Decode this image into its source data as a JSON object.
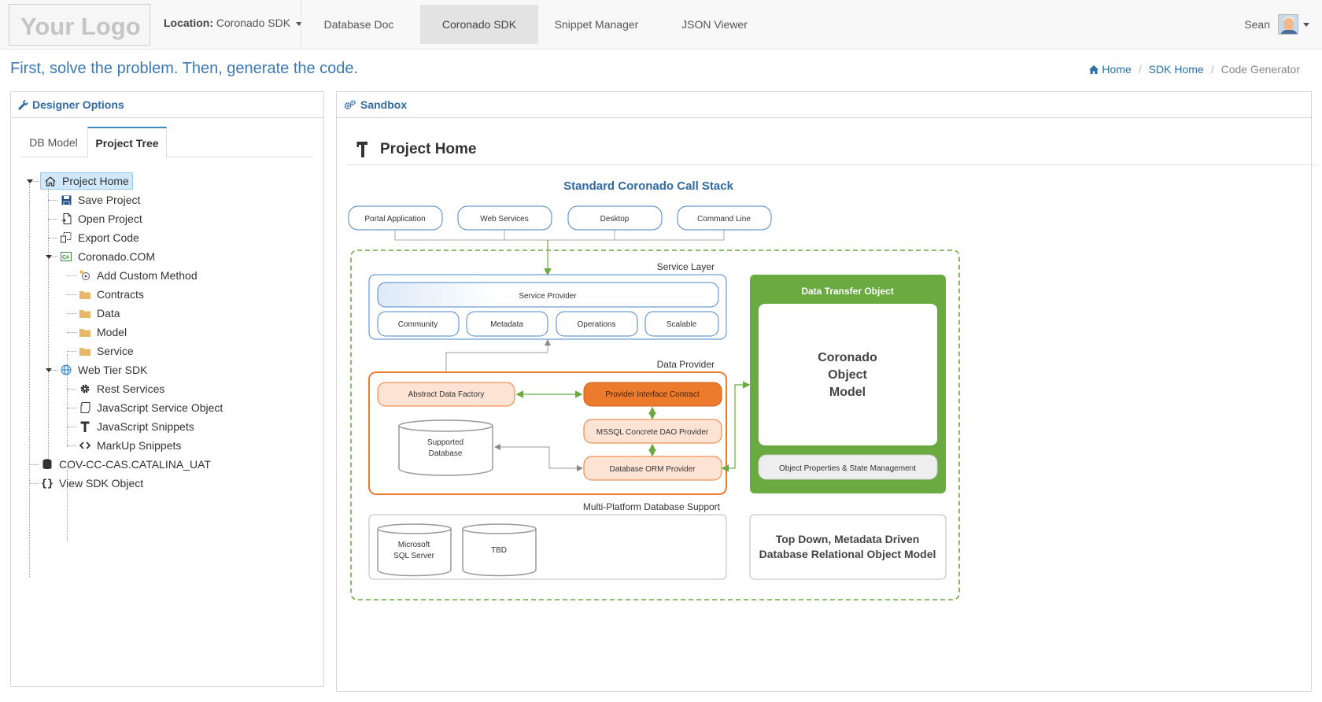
{
  "navbar": {
    "logo": "Your Logo",
    "location_label": "Location:",
    "location_value": "Coronado SDK",
    "tabs": [
      {
        "label": "Database Doc"
      },
      {
        "label": "Coronado SDK"
      },
      {
        "label": "Snippet Manager"
      },
      {
        "label": "JSON Viewer"
      }
    ],
    "user_name": "Sean"
  },
  "header": {
    "tagline": "First, solve the problem. Then, generate the code.",
    "breadcrumb": [
      "Home",
      "SDK Home",
      "Code Generator"
    ]
  },
  "designer": {
    "title": "Designer Options",
    "tabs": [
      "DB Model",
      "Project Tree"
    ],
    "tree": [
      {
        "label": "Project Home",
        "icon": "home-icon"
      },
      {
        "label": "Save Project",
        "icon": "save-icon"
      },
      {
        "label": "Open Project",
        "icon": "open-file-icon"
      },
      {
        "label": "Export Code",
        "icon": "export-icon"
      },
      {
        "label": "Coronado.COM",
        "icon": "component-icon"
      },
      {
        "label": "Add Custom Method",
        "icon": "add-method-icon"
      },
      {
        "label": "Contracts",
        "icon": "folder-icon"
      },
      {
        "label": "Data",
        "icon": "folder-icon"
      },
      {
        "label": "Model",
        "icon": "folder-icon"
      },
      {
        "label": "Service",
        "icon": "folder-icon"
      },
      {
        "label": "Web Tier SDK",
        "icon": "globe-icon"
      },
      {
        "label": "Rest Services",
        "icon": "gear-icon"
      },
      {
        "label": "JavaScript Service Object",
        "icon": "script-icon"
      },
      {
        "label": "JavaScript Snippets",
        "icon": "hammer-icon"
      },
      {
        "label": "MarkUp Snippets",
        "icon": "code-icon"
      },
      {
        "label": "COV-CC-CAS.CATALINA_UAT",
        "icon": "database-icon"
      },
      {
        "label": "View SDK Object",
        "icon": "braces-icon"
      }
    ]
  },
  "sandbox": {
    "title": "Sandbox",
    "project_title": "Project Home"
  },
  "diagram": {
    "title": "Standard Coronado Call Stack",
    "clients": [
      "Portal Application",
      "Web Services",
      "Desktop",
      "Command Line"
    ],
    "service_layer": {
      "label": "Service Layer",
      "provider": "Service Provider",
      "items": [
        "Community",
        "Metadata",
        "Operations",
        "Scalable"
      ]
    },
    "data_provider": {
      "label": "Data Provider",
      "abstract_factory": "Abstract Data Factory",
      "interface_contract": "Provider Interface Contract",
      "mssql_dao": "MSSQL Concrete DAO Provider",
      "orm_provider": "Database ORM Provider",
      "supported_db": [
        "Supported",
        "Database"
      ]
    },
    "dto": {
      "label": "Data Transfer Object",
      "model": [
        "Coronado",
        "Object",
        "Model"
      ],
      "footer": "Object Properties & State Management"
    },
    "multi_platform": {
      "label": "Multi-Platform Database Support",
      "db1": [
        "Microsoft",
        "SQL Server"
      ],
      "db2": "TBD"
    },
    "caption": [
      "Top Down, Metadata Driven",
      "Database Relational Object Model"
    ],
    "colors": {
      "title": "#2f6aa3",
      "green": "#6aaa40",
      "orange": "#ec7b2e",
      "peach": "#fde3d3",
      "blue_border": "#4a86c8"
    }
  }
}
